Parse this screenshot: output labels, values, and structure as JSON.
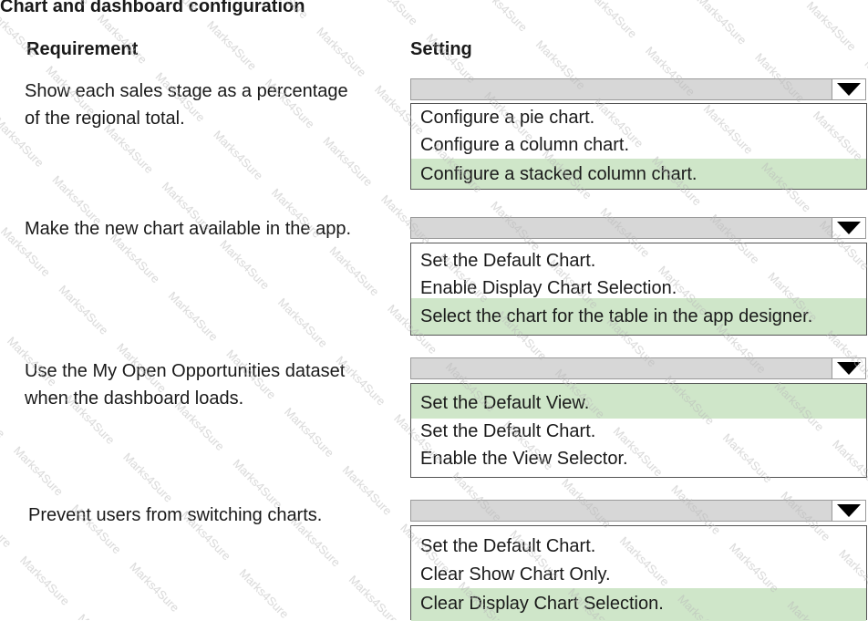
{
  "title": "Chart and dashboard configuration",
  "headers": {
    "requirement": "Requirement",
    "setting": "Setting"
  },
  "watermark_text": "Marks4Sure",
  "highlight_color": "#cfe6c9",
  "dropdown_icon": "chevron-down-icon",
  "rows": [
    {
      "requirement": [
        "Show each sales stage as a percentage",
        "of the regional total."
      ],
      "options": [
        "Configure a pie chart.",
        "Configure a column chart.",
        "Configure a stacked column chart."
      ],
      "selected": "Configure a stacked column chart."
    },
    {
      "requirement": [
        "Make the new chart available in the app."
      ],
      "options": [
        "Set the Default Chart.",
        "Enable Display Chart Selection.",
        "Select the chart for the table in the app designer."
      ],
      "selected": "Select the chart for the table in the app designer."
    },
    {
      "requirement": [
        "Use the My Open Opportunities dataset",
        "when the dashboard loads."
      ],
      "options": [
        "Set the Default View.",
        "Set the Default Chart.",
        "Enable the View Selector."
      ],
      "selected": "Set the Default View."
    },
    {
      "requirement": [
        "Prevent users from switching charts."
      ],
      "options": [
        "Set the Default Chart.",
        "Clear Show Chart Only.",
        "Clear Display Chart Selection."
      ],
      "selected": "Clear Display Chart Selection."
    }
  ]
}
